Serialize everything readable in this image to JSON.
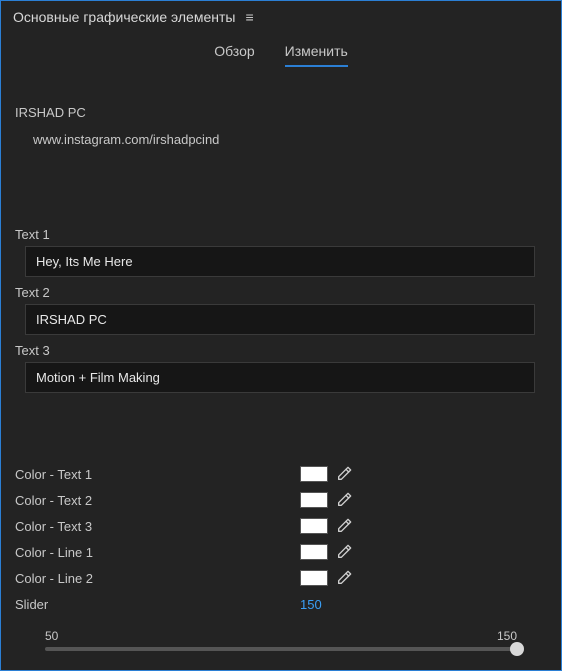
{
  "panel": {
    "title": "Основные графические элементы"
  },
  "tabs": {
    "review": "Обзор",
    "edit": "Изменить"
  },
  "top": {
    "line1": "IRSHAD PC",
    "line2": "www.instagram.com/irshadpcind"
  },
  "texts": [
    {
      "label": "Text 1",
      "value": "Hey, Its Me Here"
    },
    {
      "label": "Text 2",
      "value": "IRSHAD PC"
    },
    {
      "label": "Text 3",
      "value": "Motion + Film Making"
    }
  ],
  "colors": [
    {
      "label": "Color - Text 1",
      "hex": "#ffffff"
    },
    {
      "label": "Color - Text 2",
      "hex": "#ffffff"
    },
    {
      "label": "Color - Text 3",
      "hex": "#ffffff"
    },
    {
      "label": "Color - Line 1",
      "hex": "#ffffff"
    },
    {
      "label": "Color - Line 2",
      "hex": "#ffffff"
    }
  ],
  "slider": {
    "label": "Slider",
    "value": "150",
    "min": "50",
    "max": "150"
  }
}
